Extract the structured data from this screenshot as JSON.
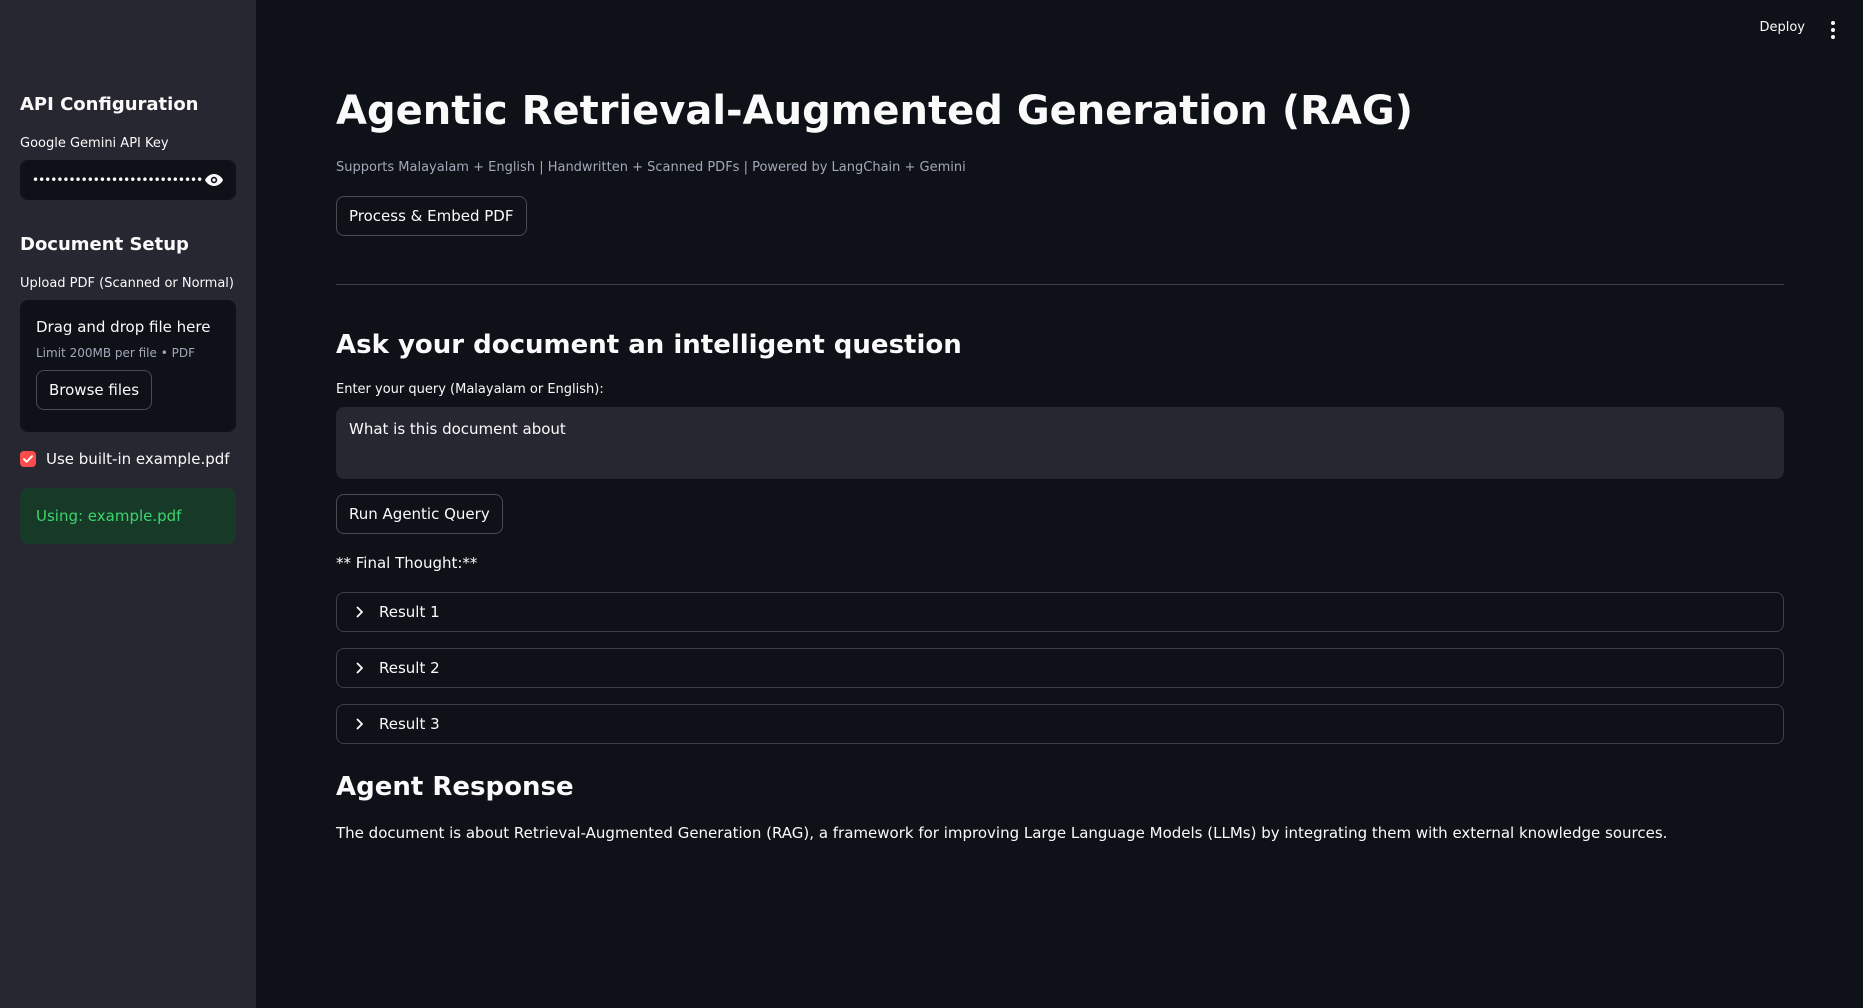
{
  "sidebar": {
    "api_heading": "API Configuration",
    "api_key_label": "Google Gemini API Key",
    "api_key_value": "••••••••••••••••••••••••••••••••••••",
    "doc_heading": "Document Setup",
    "upload_label": "Upload PDF (Scanned or Normal)",
    "dropzone_title": "Drag and drop file here",
    "dropzone_limit": "Limit 200MB per file • PDF",
    "browse_label": "Browse files",
    "checkbox_label": "Use built-in example.pdf",
    "checkbox_checked": true,
    "success_text": "Using: example.pdf"
  },
  "topbar": {
    "deploy_label": "Deploy"
  },
  "main": {
    "title": "Agentic Retrieval-Augmented Generation (RAG)",
    "subtitle": "Supports Malayalam + English | Handwritten + Scanned PDFs | Powered by LangChain + Gemini",
    "embed_button": "Process & Embed PDF",
    "ask_heading": "Ask your document an intelligent question",
    "query_label": "Enter your query (Malayalam or English):",
    "query_value": "What is this document about",
    "run_button": "Run Agentic Query",
    "final_thought": "** Final Thought:**",
    "results": [
      {
        "label": "Result 1"
      },
      {
        "label": "Result 2"
      },
      {
        "label": "Result 3"
      }
    ],
    "response_heading": "Agent Response",
    "response_text": "The document is about Retrieval-Augmented Generation (RAG), a framework for improving Large Language Models (LLMs) by integrating them with external knowledge sources."
  },
  "colors": {
    "background": "#0e1117",
    "sidebar": "#262730",
    "accent": "#ff4b4b",
    "success_bg": "#173928",
    "success_text": "#3dd56d"
  }
}
